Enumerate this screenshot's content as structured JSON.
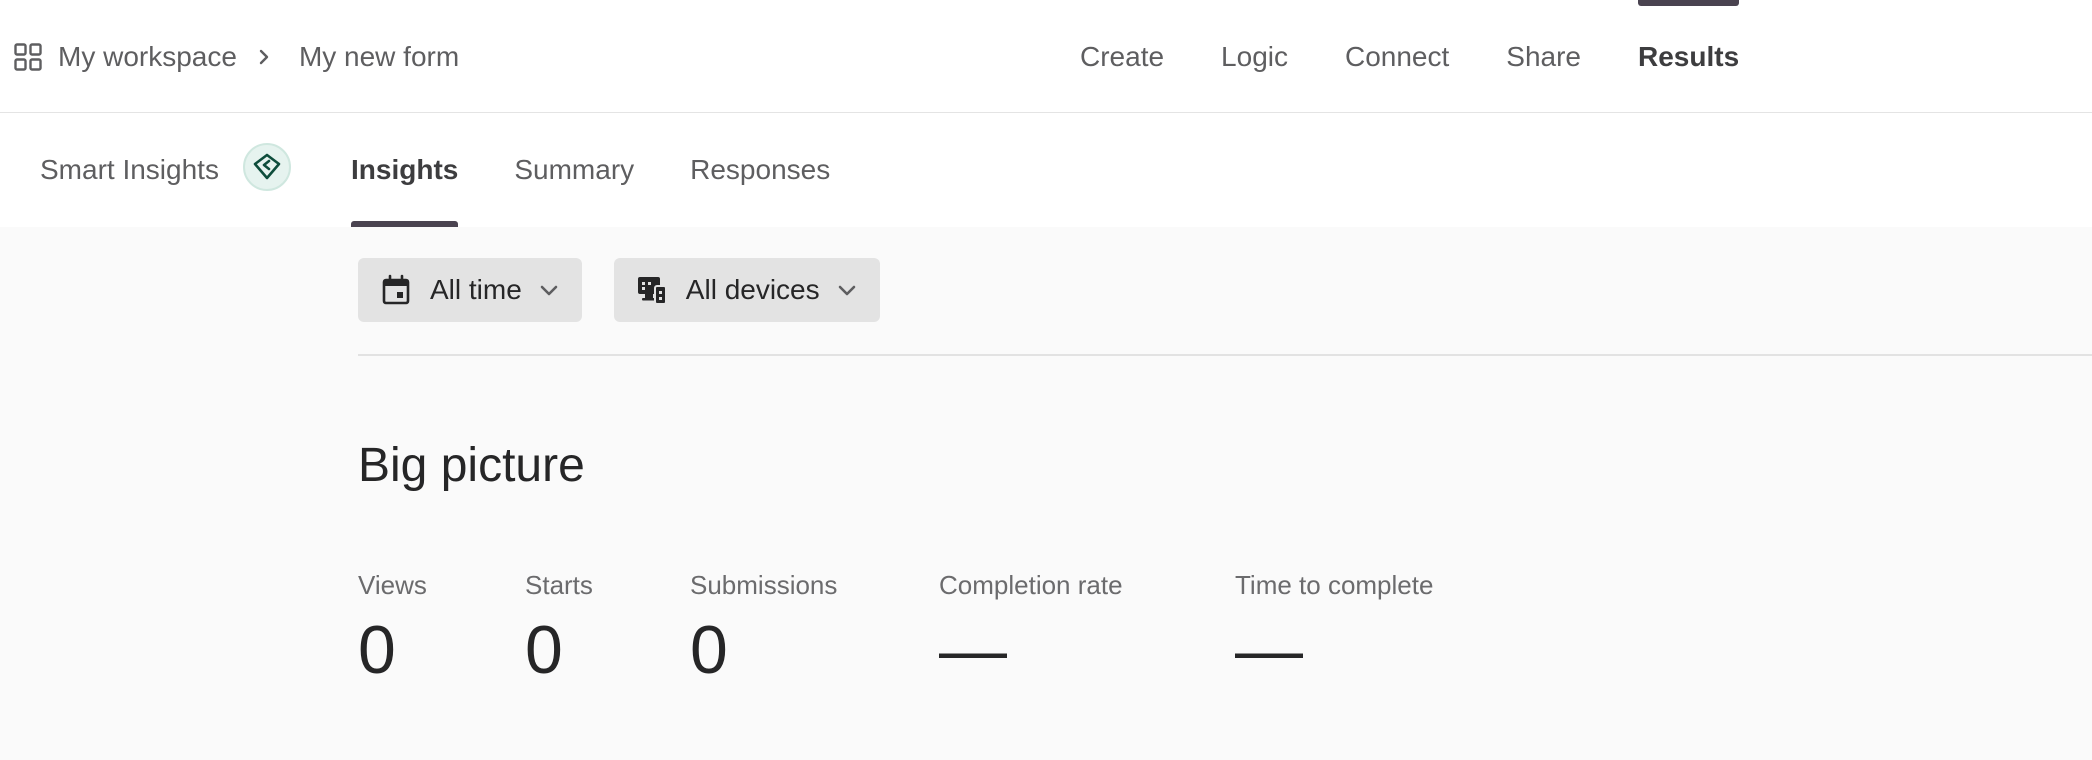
{
  "breadcrumb": {
    "workspace": "My workspace",
    "form": "My new form"
  },
  "topnav": [
    {
      "label": "Create"
    },
    {
      "label": "Logic"
    },
    {
      "label": "Connect"
    },
    {
      "label": "Share"
    },
    {
      "label": "Results",
      "active": true
    }
  ],
  "smart_insights": {
    "label": "Smart Insights"
  },
  "subtabs": [
    {
      "label": "Insights",
      "active": true
    },
    {
      "label": "Summary"
    },
    {
      "label": "Responses"
    }
  ],
  "filters": {
    "time": "All time",
    "devices": "All devices"
  },
  "section": {
    "title": "Big picture"
  },
  "metrics": [
    {
      "label": "Views",
      "value": "0"
    },
    {
      "label": "Starts",
      "value": "0"
    },
    {
      "label": "Submissions",
      "value": "0"
    },
    {
      "label": "Completion rate",
      "value": "—"
    },
    {
      "label": "Time to complete",
      "value": "—"
    }
  ],
  "colors": {
    "accent": "#4a4350",
    "gem": "#0e4d3c"
  },
  "icons": [
    "grid-icon",
    "chevron-right-icon",
    "gem-icon",
    "calendar-icon",
    "devices-icon",
    "chevron-down-icon"
  ]
}
